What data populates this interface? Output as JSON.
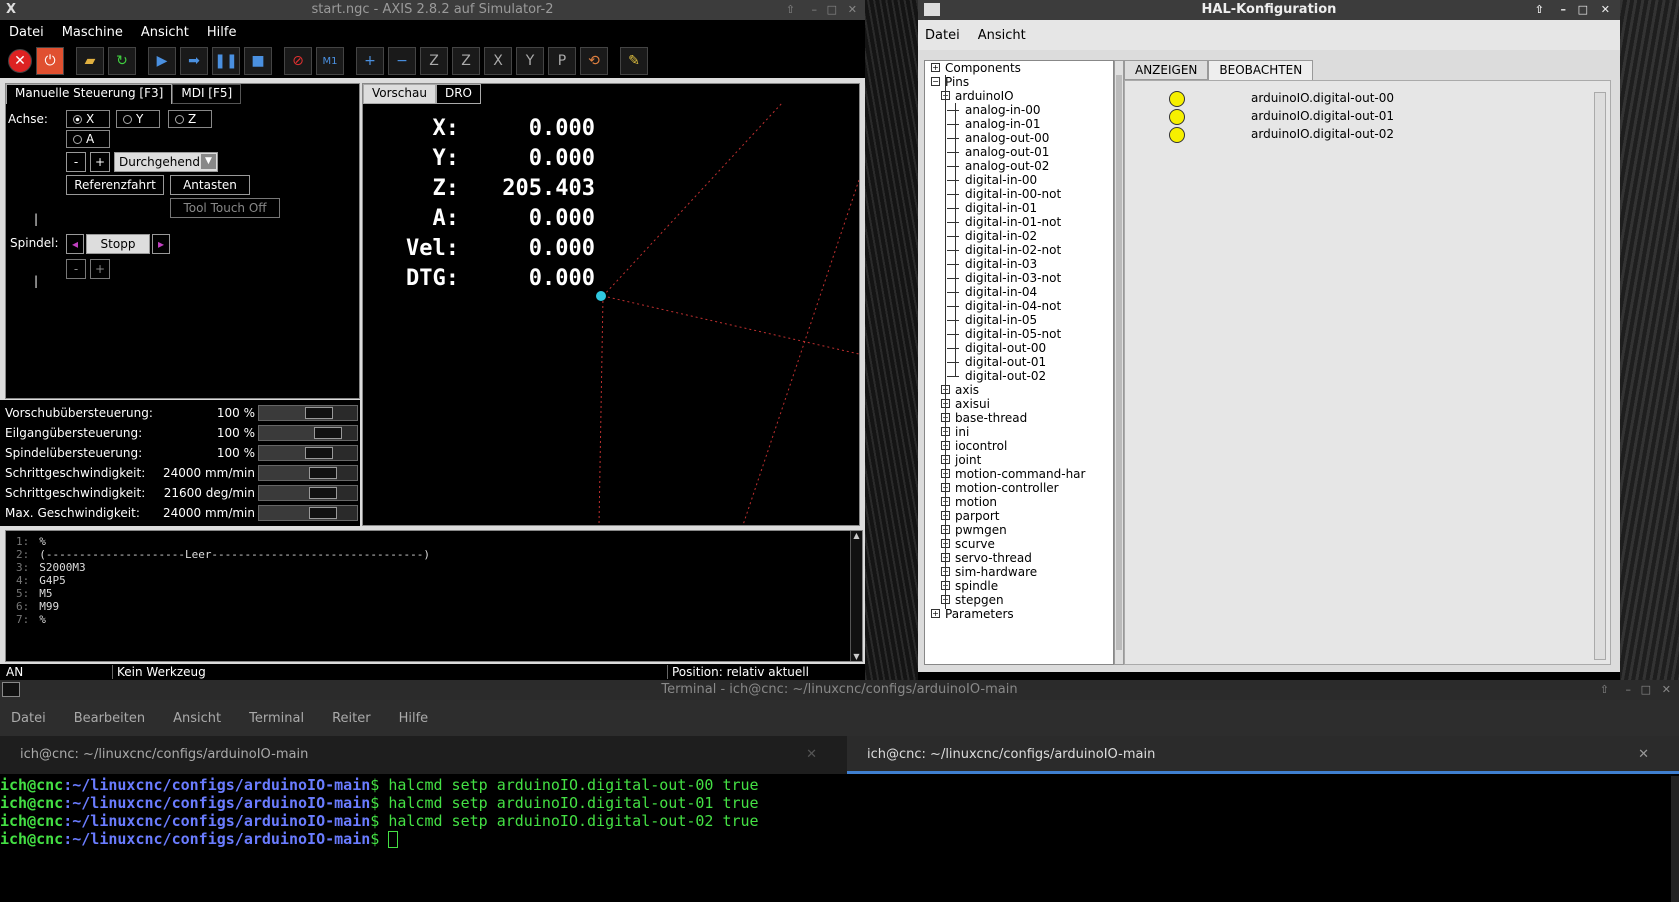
{
  "axis": {
    "title": "start.ngc - AXIS 2.8.2 auf  Simulator-2",
    "menu": [
      "Datei",
      "Maschine",
      "Ansicht",
      "Hilfe"
    ],
    "toolbar_icons": [
      "estop-icon",
      "power-icon",
      "open-file-icon",
      "reload-icon",
      "run-icon",
      "step-icon",
      "pause-icon",
      "stop-icon",
      "block-delete-icon",
      "optional-stop-icon",
      "zoom-in-icon",
      "zoom-out-icon",
      "view-z-icon",
      "view-z2-icon",
      "view-x-icon",
      "view-y-icon",
      "view-p-icon",
      "rotate-icon",
      "clear-plot-icon"
    ],
    "tabs": {
      "manual": "Manuelle Steuerung [F3]",
      "mdi": "MDI [F5]"
    },
    "axis_label": "Achse:",
    "axes": [
      "X",
      "Y",
      "Z",
      "A"
    ],
    "jog_minus": "-",
    "jog_plus": "+",
    "jog_mode": "Durchgehend",
    "home_button": "Referenzfahrt",
    "touch_button": "Antasten",
    "tool_touch_off": "Tool Touch Off",
    "spindle_label": "Spindel:",
    "spindle_stop": "Stopp",
    "overrides": [
      {
        "label": "Vorschubübersteuerung:",
        "value": "100 %",
        "level": 0.75
      },
      {
        "label": "Eilgangübersteuerung:",
        "value": "100 %",
        "level": 0.85
      },
      {
        "label": "Spindelübersteuerung:",
        "value": "100 %",
        "level": 0.75
      },
      {
        "label": "Schrittgeschwindigkeit:",
        "value": "24000 mm/min",
        "level": 0.8
      },
      {
        "label": "Schrittgeschwindigkeit:",
        "value": "21600 deg/min",
        "level": 0.8
      },
      {
        "label": "Max. Geschwindigkeit:",
        "value": "24000 mm/min",
        "level": 0.8
      }
    ],
    "preview_tabs": {
      "preview": "Vorschau",
      "dro": "DRO"
    },
    "dro": [
      {
        "label": "X:",
        "value": "0.000"
      },
      {
        "label": "Y:",
        "value": "0.000"
      },
      {
        "label": "Z:",
        "value": "205.403"
      },
      {
        "label": "A:",
        "value": "0.000"
      },
      {
        "label": "Vel:",
        "value": "0.000"
      },
      {
        "label": "DTG:",
        "value": "0.000"
      }
    ],
    "gcode": [
      {
        "n": "1:",
        "t": "%"
      },
      {
        "n": "2:",
        "t": "(---------------------Leer--------------------------------)"
      },
      {
        "n": "3:",
        "t": "S2000M3"
      },
      {
        "n": "4:",
        "t": "G4P5"
      },
      {
        "n": "5:",
        "t": "M5"
      },
      {
        "n": "6:",
        "t": "M99"
      },
      {
        "n": "7:",
        "t": "%"
      }
    ],
    "status": {
      "state": "AN",
      "tool": "Kein Werkzeug",
      "position": "Position: relativ aktuell"
    }
  },
  "hal": {
    "title": "HAL-Konfiguration",
    "menu": [
      "Datei",
      "Ansicht"
    ],
    "tree_top": [
      "Components",
      "Pins",
      "arduinoIO"
    ],
    "arduino_pins": [
      "analog-in-00",
      "analog-in-01",
      "analog-out-00",
      "analog-out-01",
      "analog-out-02",
      "digital-in-00",
      "digital-in-00-not",
      "digital-in-01",
      "digital-in-01-not",
      "digital-in-02",
      "digital-in-02-not",
      "digital-in-03",
      "digital-in-03-not",
      "digital-in-04",
      "digital-in-04-not",
      "digital-in-05",
      "digital-in-05-not",
      "digital-out-00",
      "digital-out-01",
      "digital-out-02"
    ],
    "components": [
      "axis",
      "axisui",
      "base-thread",
      "ini",
      "iocontrol",
      "joint",
      "motion-command-har",
      "motion-controller",
      "motion",
      "parport",
      "pwmgen",
      "scurve",
      "servo-thread",
      "sim-hardware",
      "spindle",
      "stepgen"
    ],
    "parameters": "Parameters",
    "tabs": {
      "show": "ANZEIGEN",
      "watch": "BEOBACHTEN"
    },
    "watched": [
      "arduinoIO.digital-out-00",
      "arduinoIO.digital-out-01",
      "arduinoIO.digital-out-02"
    ]
  },
  "terminal": {
    "title": "Terminal - ich@cnc: ~/linuxcnc/configs/arduinoIO-main",
    "menu": [
      "Datei",
      "Bearbeiten",
      "Ansicht",
      "Terminal",
      "Reiter",
      "Hilfe"
    ],
    "tabs": [
      "ich@cnc: ~/linuxcnc/configs/arduinoIO-main",
      "ich@cnc: ~/linuxcnc/configs/arduinoIO-main"
    ],
    "user": "ich@cnc",
    "path": ":~/linuxcnc/configs/arduinoIO-main",
    "prompt": "$",
    "commands": [
      "halcmd setp arduinoIO.digital-out-00 true",
      "halcmd setp arduinoIO.digital-out-01 true",
      "halcmd setp arduinoIO.digital-out-02 true"
    ]
  },
  "colors": {
    "led_on": "#f6f000",
    "prompt_user": "#44e044",
    "prompt_path": "#6a7cff",
    "preview_lines": "#c03030"
  }
}
